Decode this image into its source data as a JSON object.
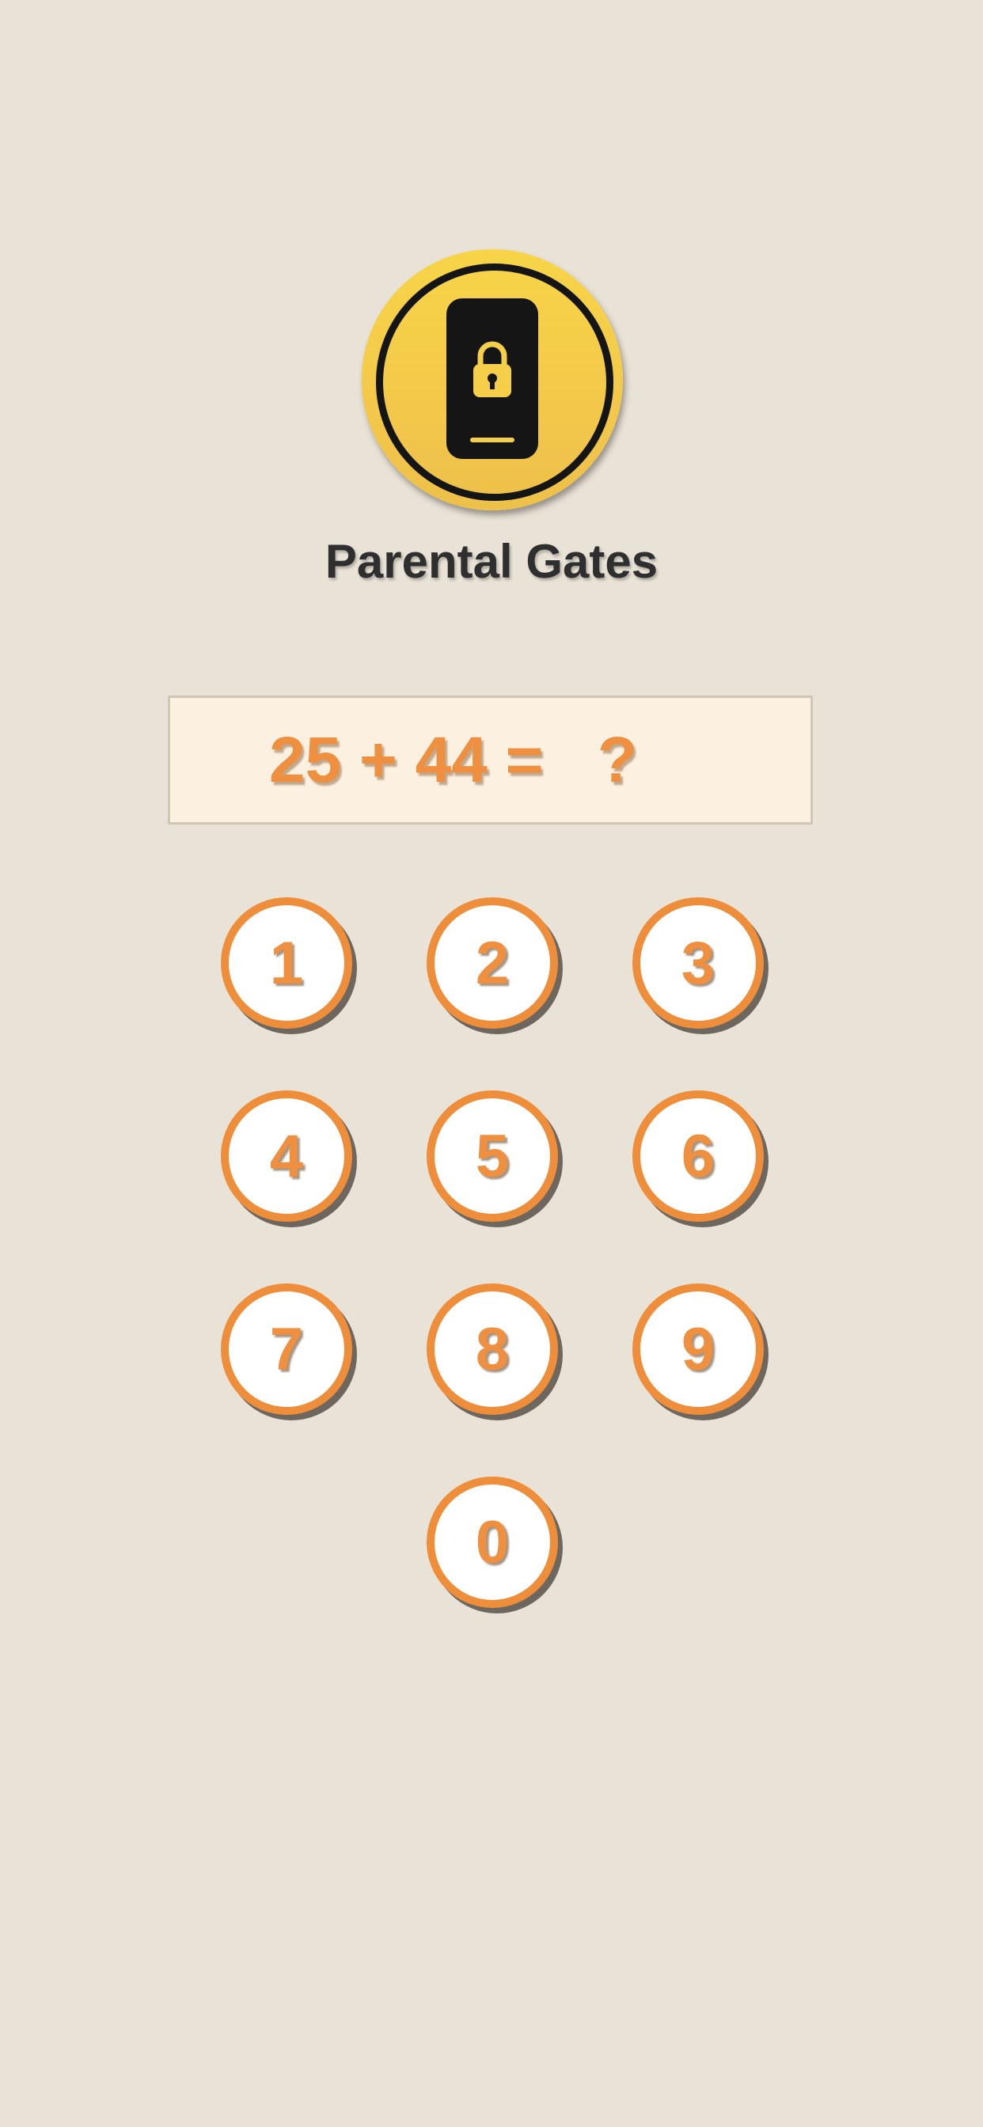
{
  "header": {
    "icon": "phone-lock-icon",
    "title": "Parental Gates"
  },
  "question": {
    "text": "25 + 44 =   ?"
  },
  "keypad": {
    "keys": [
      "1",
      "2",
      "3",
      "4",
      "5",
      "6",
      "7",
      "8",
      "9",
      "0"
    ]
  },
  "colors": {
    "background": "#e9e2d6",
    "accent": "#ee8e3b",
    "logo": "#f5cf49"
  }
}
